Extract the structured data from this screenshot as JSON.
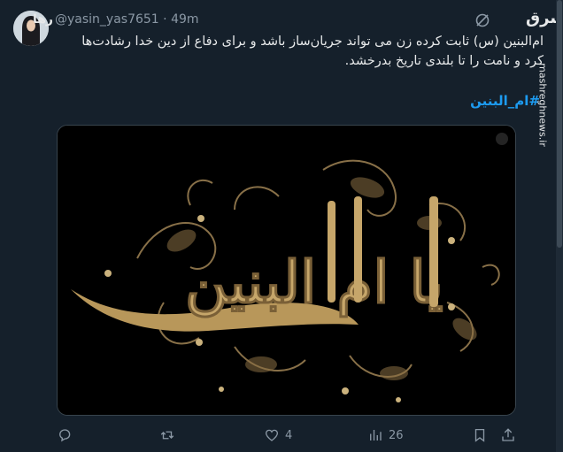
{
  "tweet": {
    "author_name": "رها",
    "handle": "@yasin_yas7651",
    "separator": "·",
    "time": "49m",
    "text_line1": "ام‌البنین (س) ثابت کرده زن می تواند جریان‌ساز باشد و برای دفاع از دین خدا رشادت‌ها",
    "text_line2": "کرد و نامت را تا بلندی تاریخ بدرخشد.",
    "hashtag": "#ام_البنین"
  },
  "media": {
    "calligraphy_text": "یا ام البنین",
    "background_color": "#000000",
    "gold_color": "#b8975a"
  },
  "actions": {
    "reply_count": "",
    "retweet_count": "",
    "like_count": "4",
    "views_count": "26"
  },
  "watermark": {
    "logo": "مشرق",
    "url": "mashreghnews.ir"
  }
}
